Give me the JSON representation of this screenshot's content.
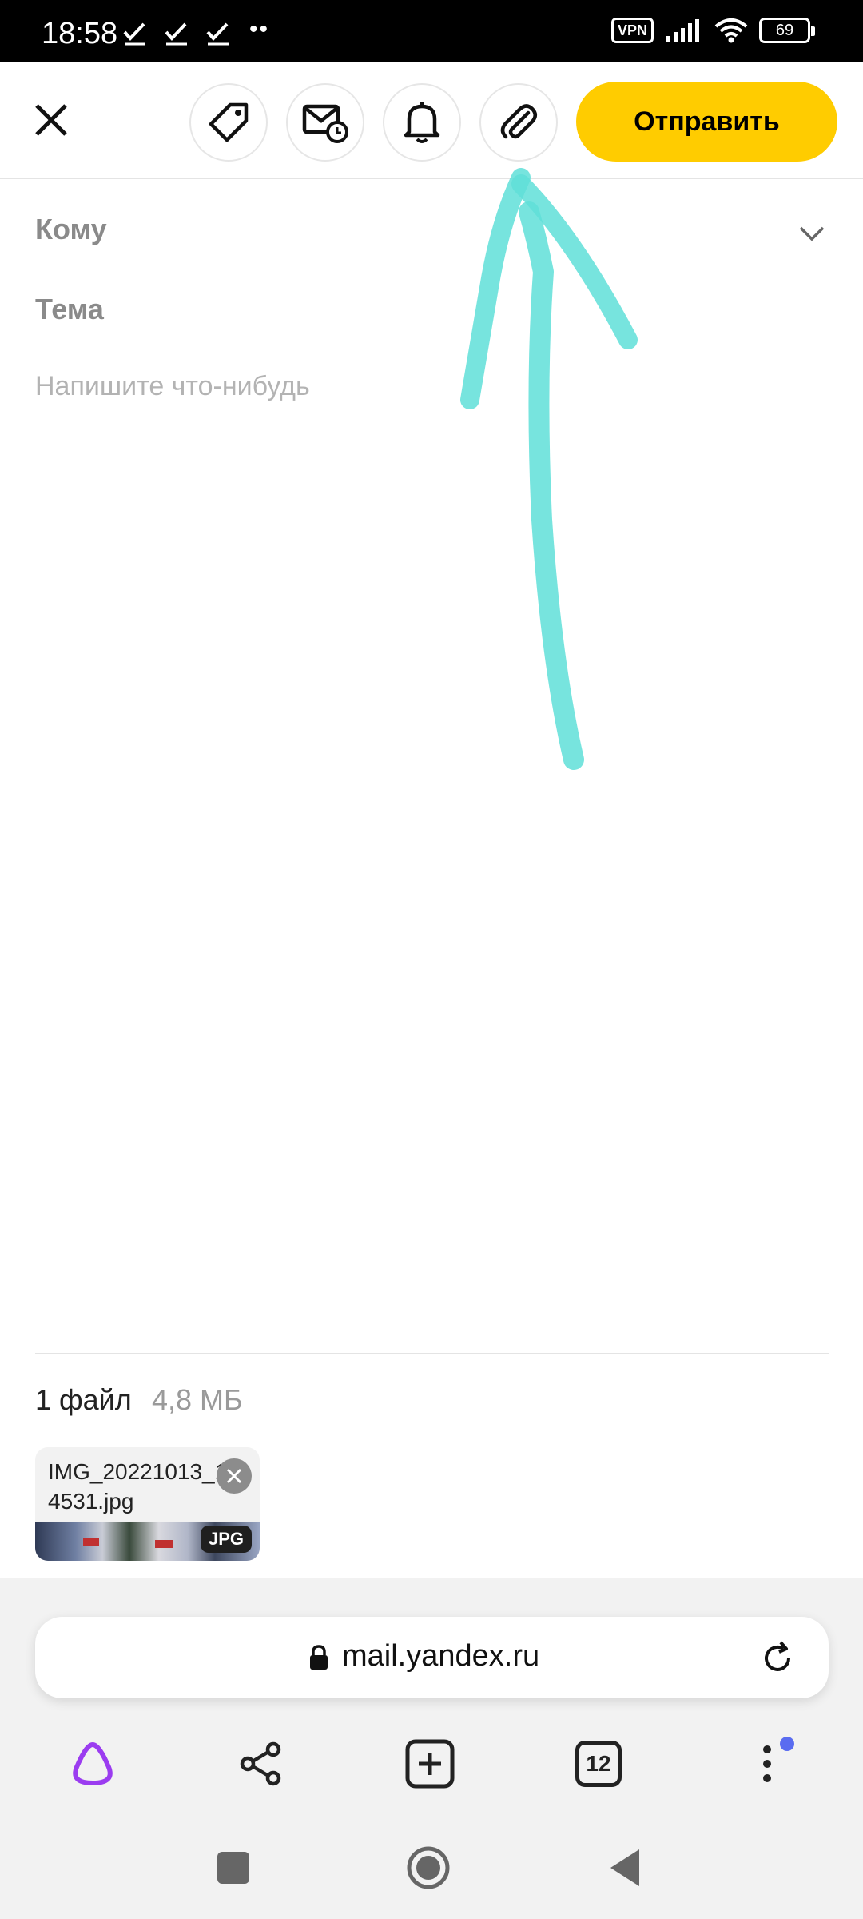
{
  "status_bar": {
    "time": "18:58",
    "dots": "••",
    "vpn": "VPN",
    "battery": "69"
  },
  "toolbar": {
    "send_label": "Отправить",
    "accent_color": "#ffcc00"
  },
  "compose": {
    "to_label": "Кому",
    "subject_label": "Тема",
    "body_placeholder": "Напишите что-нибудь"
  },
  "attachments": {
    "count_label": "1 файл",
    "total_size": "4,8 МБ",
    "files": [
      {
        "name": "IMG_20221013_154531.jpg",
        "type": "JPG"
      }
    ]
  },
  "browser": {
    "url": "mail.yandex.ru",
    "tabs_count": "12"
  },
  "annotation": {
    "color": "#5fdfd8"
  }
}
